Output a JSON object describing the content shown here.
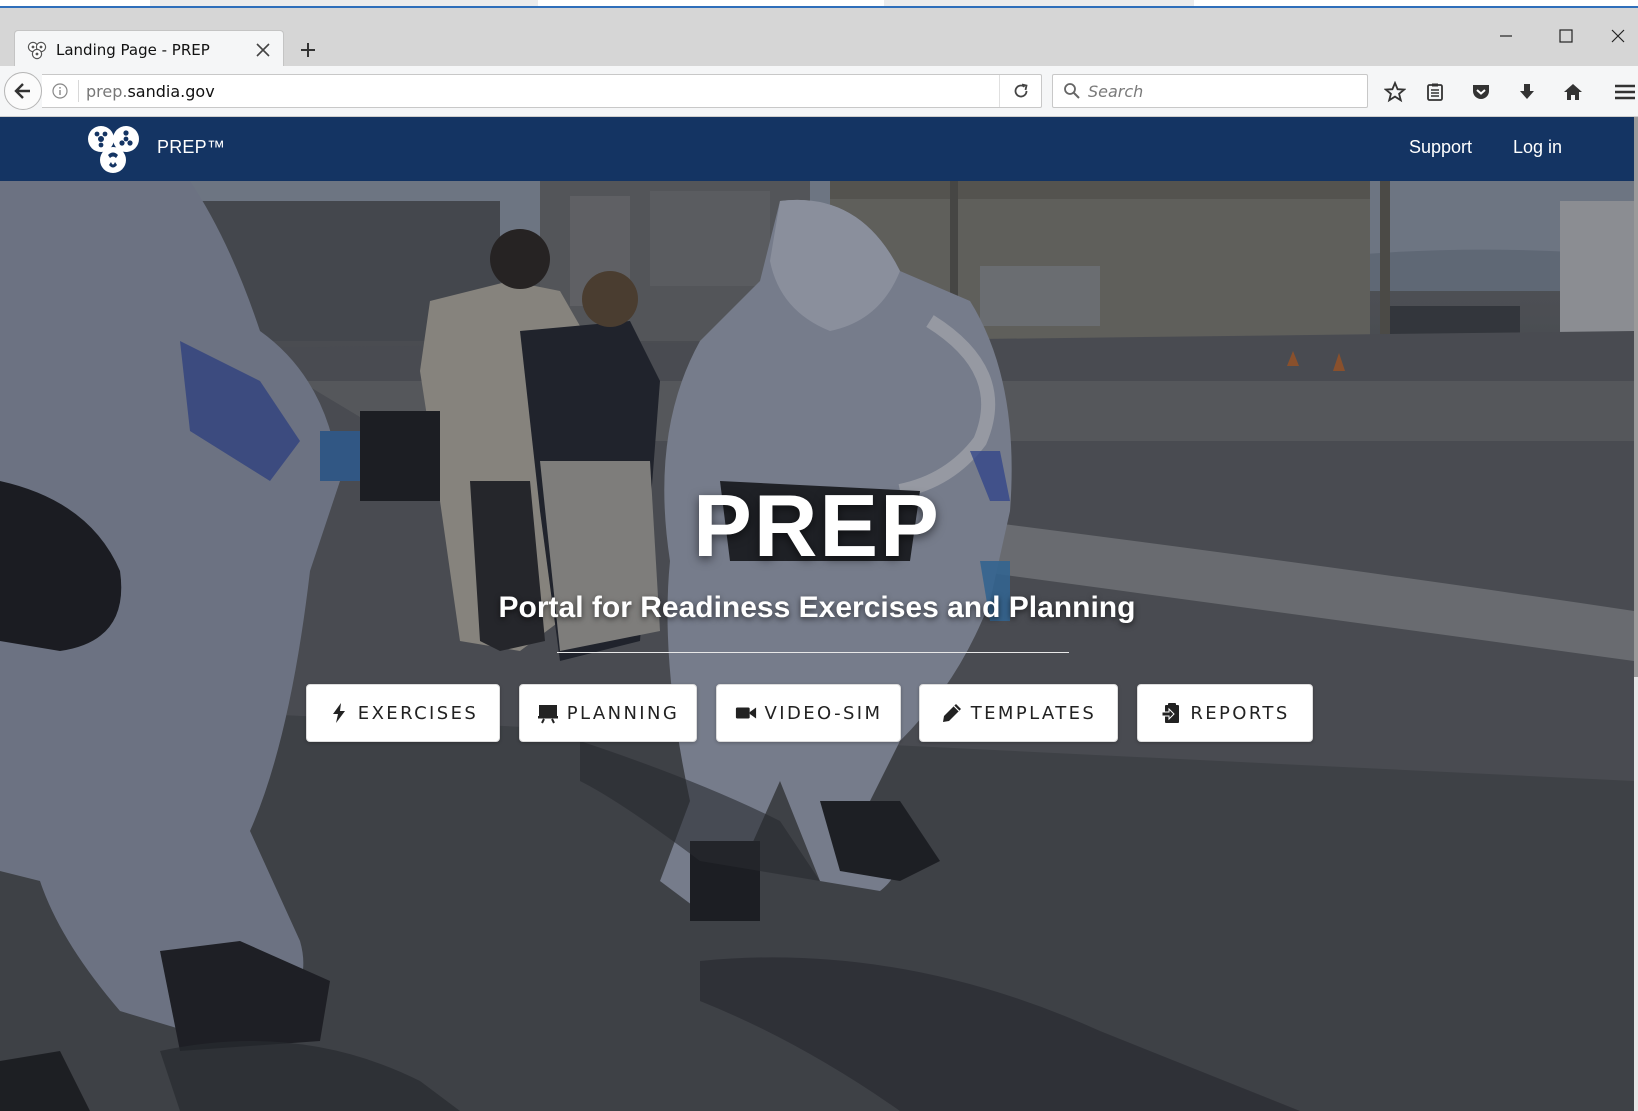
{
  "browser": {
    "tab": {
      "title": "Landing Page - PREP",
      "favicon": "biohazard-trio-icon"
    },
    "new_tab_icon": "plus-icon",
    "window_controls": [
      "minimize-icon",
      "maximize-icon",
      "close-icon"
    ],
    "address": {
      "host_prefix": "prep.",
      "host_domain": "sandia.gov"
    },
    "search": {
      "placeholder": "Search"
    },
    "toolbar_icons": [
      "star-icon",
      "reading-list-icon",
      "pocket-icon",
      "download-icon",
      "home-icon",
      "menu-icon"
    ]
  },
  "site": {
    "brand": "PREP™",
    "nav_links": [
      {
        "label": "Support"
      },
      {
        "label": "Log in"
      }
    ],
    "colors": {
      "navbar": "#143463",
      "button_bg": "#ffffff",
      "hero_text": "#ffffff"
    }
  },
  "hero": {
    "title": "PREP",
    "subtitle": "Portal for Readiness Exercises and Planning",
    "buttons": [
      {
        "label": "EXERCISES",
        "icon": "lightning-bolt-icon"
      },
      {
        "label": "PLANNING",
        "icon": "presentation-board-icon"
      },
      {
        "label": "VIDEO-SIM",
        "icon": "video-camera-icon"
      },
      {
        "label": "TEMPLATES",
        "icon": "pencil-icon"
      },
      {
        "label": "REPORTS",
        "icon": "clipboard-icon"
      }
    ]
  }
}
